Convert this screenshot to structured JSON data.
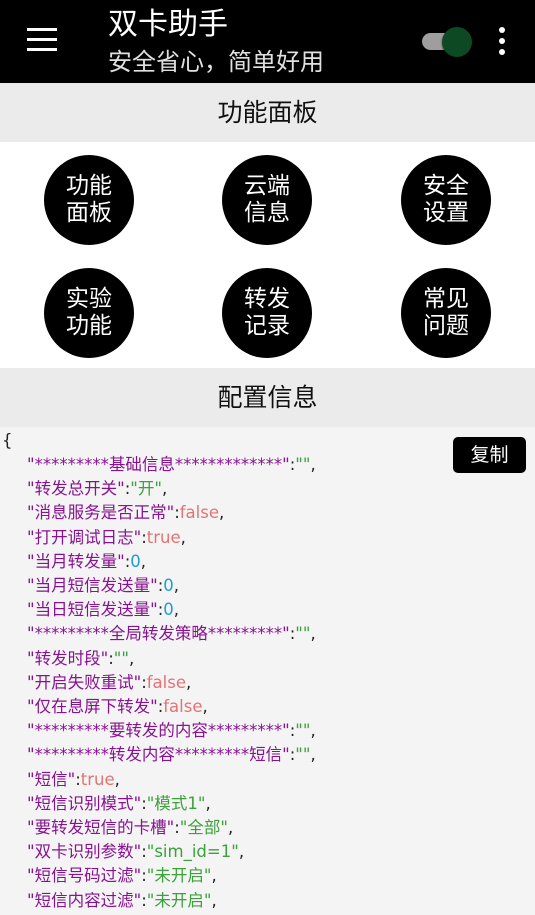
{
  "app": {
    "title": "双卡助手",
    "subtitle": "安全省心，简单好用",
    "toggle_on": true,
    "colors": {
      "appbar": "#000000",
      "toggle_thumb": "#0d4a24"
    }
  },
  "sections": {
    "panel_title": "功能面板",
    "config_title": "配置信息"
  },
  "panel_buttons": [
    "功能\n面板",
    "云端\n信息",
    "安全\n设置",
    "实验\n功能",
    "转发\n记录",
    "常见\n问题"
  ],
  "copy_label": "复制",
  "json_open": "{",
  "config_lines": [
    {
      "key": "\"*********基础信息*************\"",
      "value": "\"\"",
      "type": "str"
    },
    {
      "key": "\"转发总开关\"",
      "value": "\"开\"",
      "type": "str"
    },
    {
      "key": "\"消息服务是否正常\"",
      "value": "false",
      "type": "bool"
    },
    {
      "key": "\"打开调试日志\"",
      "value": "true",
      "type": "bool"
    },
    {
      "key": "\"当月转发量\"",
      "value": "0",
      "type": "num"
    },
    {
      "key": "\"当月短信发送量\"",
      "value": "0",
      "type": "num"
    },
    {
      "key": "\"当日短信发送量\"",
      "value": "0",
      "type": "num"
    },
    {
      "key": "\"*********全局转发策略*********\"",
      "value": "\"\"",
      "type": "str"
    },
    {
      "key": "\"转发时段\"",
      "value": "\"\"",
      "type": "str"
    },
    {
      "key": "\"开启失败重试\"",
      "value": "false",
      "type": "bool"
    },
    {
      "key": "\"仅在息屏下转发\"",
      "value": "false",
      "type": "bool"
    },
    {
      "key": "\"*********要转发的内容*********\"",
      "value": "\"\"",
      "type": "str"
    },
    {
      "key": "\"*********转发内容*********短信\"",
      "value": "\"\"",
      "type": "str"
    },
    {
      "key": "\"短信\"",
      "value": "true",
      "type": "bool"
    },
    {
      "key": "\"短信识别模式\"",
      "value": "\"模式1\"",
      "type": "str"
    },
    {
      "key": "\"要转发短信的卡槽\"",
      "value": "\"全部\"",
      "type": "str"
    },
    {
      "key": "\"双卡识别参数\"",
      "value": "\"sim_id=1\"",
      "type": "str"
    },
    {
      "key": "\"短信号码过滤\"",
      "value": "\"未开启\"",
      "type": "str"
    },
    {
      "key": "\"短信内容过滤\"",
      "value": "\"未开启\"",
      "type": "str"
    }
  ],
  "json_separator": ":",
  "json_comma": ","
}
